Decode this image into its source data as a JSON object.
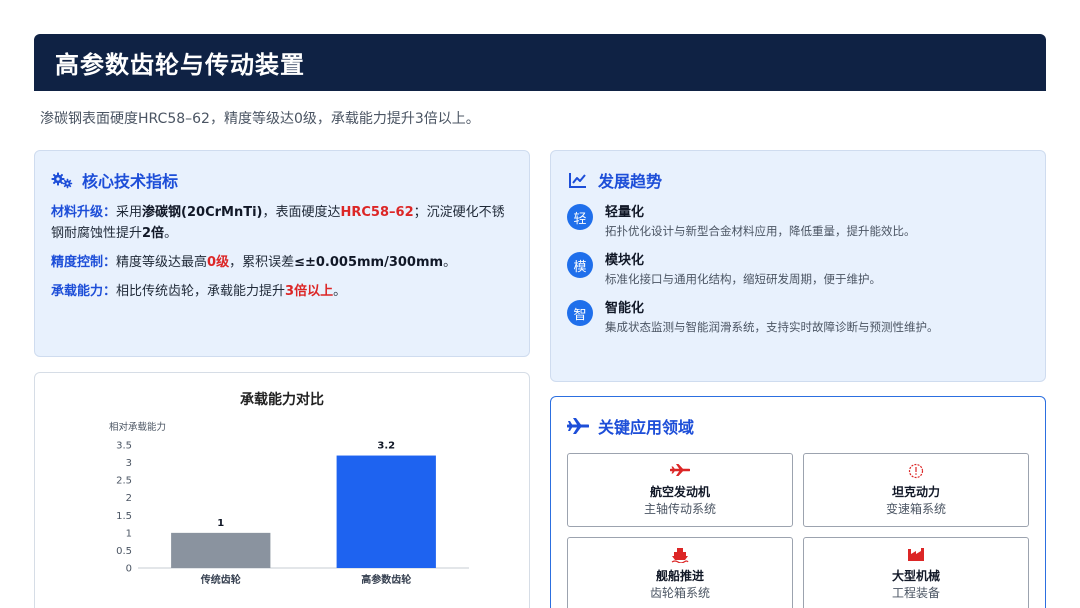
{
  "header": {
    "title": "高参数齿轮与传动装置"
  },
  "subtitle": "渗碳钢表面硬度HRC58–62，精度等级达0级，承载能力提升3倍以上。",
  "core": {
    "title": "核心技术指标",
    "icon": "gears-icon",
    "items": [
      {
        "key": "材料升级：",
        "t1": "采用",
        "b1": "渗碳钢(20CrMnTi)",
        "t2": "，表面硬度达",
        "r1": "HRC58–62",
        "t3": "；沉淀硬化不锈钢耐腐蚀性提升",
        "b2": "2倍",
        "t4": "。"
      },
      {
        "key": "精度控制：",
        "t1": "精度等级达最高",
        "r1": "0级",
        "t2": "，累积误差",
        "b1": "≤±0.005mm/300mm",
        "t3": "。"
      },
      {
        "key": "承载能力：",
        "t1": "相比传统齿轮，承载能力提升",
        "r1": "3倍以上",
        "t2": "。"
      }
    ]
  },
  "trends": {
    "title": "发展趋势",
    "icon": "trend-chart-icon",
    "items": [
      {
        "badge": "轻",
        "title": "轻量化",
        "desc": "拓扑优化设计与新型合金材料应用，降低重量，提升能效比。"
      },
      {
        "badge": "模",
        "title": "模块化",
        "desc": "标准化接口与通用化结构，缩短研发周期，便于维护。"
      },
      {
        "badge": "智",
        "title": "智能化",
        "desc": "集成状态监测与智能润滑系统，支持实时故障诊断与预测性维护。"
      }
    ]
  },
  "applications": {
    "title": "关键应用领域",
    "icon": "airplane-icon",
    "items": [
      {
        "icon": "jet-icon",
        "name": "航空发动机",
        "desc": "主轴传动系统"
      },
      {
        "icon": "gauge-icon",
        "name": "坦克动力",
        "desc": "变速箱系统"
      },
      {
        "icon": "ship-icon",
        "name": "舰船推进",
        "desc": "齿轮箱系统"
      },
      {
        "icon": "factory-icon",
        "name": "大型机械",
        "desc": "工程装备"
      }
    ]
  },
  "chart_data": {
    "type": "bar",
    "title": "承载能力对比",
    "ylabel": "相对承载能力",
    "xlabel": "",
    "categories": [
      "传统齿轮",
      "高参数齿轮"
    ],
    "values": [
      1,
      3.2
    ],
    "data_labels": [
      "1",
      "3.2"
    ],
    "colors": [
      "#8a939f",
      "#1e63f0"
    ],
    "ylim": [
      0,
      3.5
    ],
    "yticks": [
      "0",
      "0.5",
      "1",
      "1.5",
      "2",
      "2.5",
      "3",
      "3.5"
    ],
    "grid": false,
    "legend": "none"
  }
}
